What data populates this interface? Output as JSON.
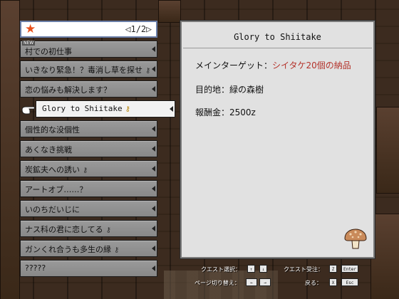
{
  "list": {
    "star_icon": "star-icon",
    "pager_prev_icon": "triangle-left-icon",
    "pager_next_icon": "triangle-right-icon",
    "page": "1/2",
    "new_badge": "NEW",
    "items": [
      {
        "label": "村での初仕事",
        "has_key": false
      },
      {
        "label": "いきなり緊急！？毒消し草を探せ",
        "has_key": true
      },
      {
        "label": "恋の悩みも解決します？",
        "has_key": false
      },
      {
        "label": "Glory to Shiitake",
        "has_key": true,
        "selected": true
      },
      {
        "label": "個性的な没個性",
        "has_key": false
      },
      {
        "label": "あくなき挑戦",
        "has_key": false
      },
      {
        "label": "炭鉱夫への誘い",
        "has_key": true
      },
      {
        "label": "アートオブ……？",
        "has_key": false
      },
      {
        "label": "いのちだいじに",
        "has_key": false
      },
      {
        "label": "ナス科の君に恋してる",
        "has_key": true
      },
      {
        "label": "ガンくれ合うも多生の縁",
        "has_key": true
      },
      {
        "label": "?????",
        "has_key": false
      }
    ],
    "key_glyph": "⚷"
  },
  "detail": {
    "title": "Glory to Shiitake",
    "target_label": "メインターゲット：",
    "target_value": "シイタケ20個の納品",
    "destination": "目的地：緑の森樹",
    "reward": "報酬金：2500z",
    "accent_color": "#b4322a"
  },
  "hints": {
    "quest_select": "クエスト選択：",
    "quest_accept": "クエスト受注：",
    "page_switch": "ページ切り替え：",
    "back": "戻る：",
    "keys": {
      "up": "↑",
      "down": "↓",
      "z": "Z",
      "enter": "Enter",
      "left": "←",
      "right": "→",
      "x": "X",
      "esc": "Esc"
    }
  }
}
